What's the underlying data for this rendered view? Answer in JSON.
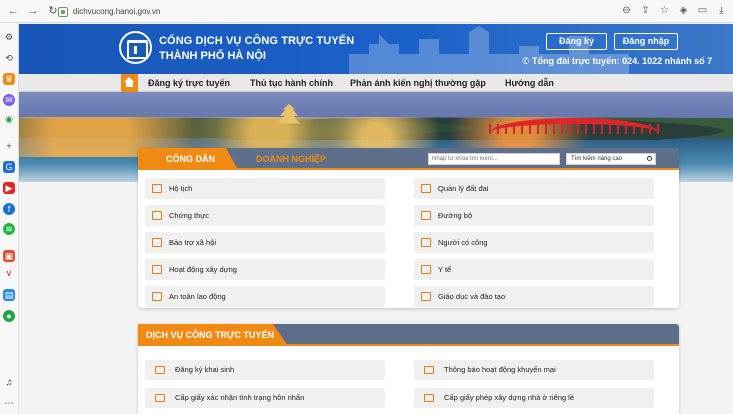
{
  "browser": {
    "url": "dichvucong.hanoi.gov.vn"
  },
  "header": {
    "title_line1": "CỔNG DỊCH VỤ CÔNG TRỰC TUYẾN",
    "title_line2": "THÀNH PHỐ HÀ NỘI",
    "register_label": "Đăng ký",
    "login_label": "Đăng nhập",
    "hotline": "Tổng đài trực tuyến: 024. 1022 nhánh số 7"
  },
  "menu": {
    "items": [
      {
        "label": "Đăng ký trực tuyến"
      },
      {
        "label": "Thủ tục hành chính"
      },
      {
        "label": "Phản ánh kiến nghị thường gặp"
      },
      {
        "label": "Hướng dẫn"
      }
    ]
  },
  "tabs": {
    "citizen": "CÔNG DÂN",
    "business": "DOANH NGHIỆP",
    "search_placeholder": "Nhập từ khóa tìm kiếm...",
    "advanced_search": "Tìm kiếm nâng cao"
  },
  "categories": [
    {
      "label": "Hộ tịch",
      "icon": "registry-book-icon"
    },
    {
      "label": "Quản lý đất đai",
      "icon": "land-management-icon"
    },
    {
      "label": "Chứng thực",
      "icon": "certification-icon"
    },
    {
      "label": "Đường bộ",
      "icon": "road-icon"
    },
    {
      "label": "Bảo trợ xã hội",
      "icon": "social-welfare-icon"
    },
    {
      "label": "Người có công",
      "icon": "merit-medal-icon"
    },
    {
      "label": "Hoạt động xây dựng",
      "icon": "construction-icon"
    },
    {
      "label": "Y tế",
      "icon": "health-cross-icon"
    },
    {
      "label": "An toàn lao động",
      "icon": "labor-safety-icon"
    },
    {
      "label": "Giáo dục và đào tạo",
      "icon": "education-book-icon"
    }
  ],
  "online_services": {
    "title": "DỊCH VỤ CÔNG TRỰC TUYẾN",
    "items": [
      {
        "label": "Đăng ký khai sinh"
      },
      {
        "label": "Thông báo hoạt động khuyến mại"
      },
      {
        "label": "Cấp giấy xác nhận tình trạng hôn nhân"
      },
      {
        "label": "Cấp giấy phép xây dựng nhà ở riêng lẻ"
      }
    ]
  },
  "colors": {
    "header_blue": "#1856b8",
    "accent_orange": "#f08a12",
    "tab_bar": "#5d6f8a"
  }
}
